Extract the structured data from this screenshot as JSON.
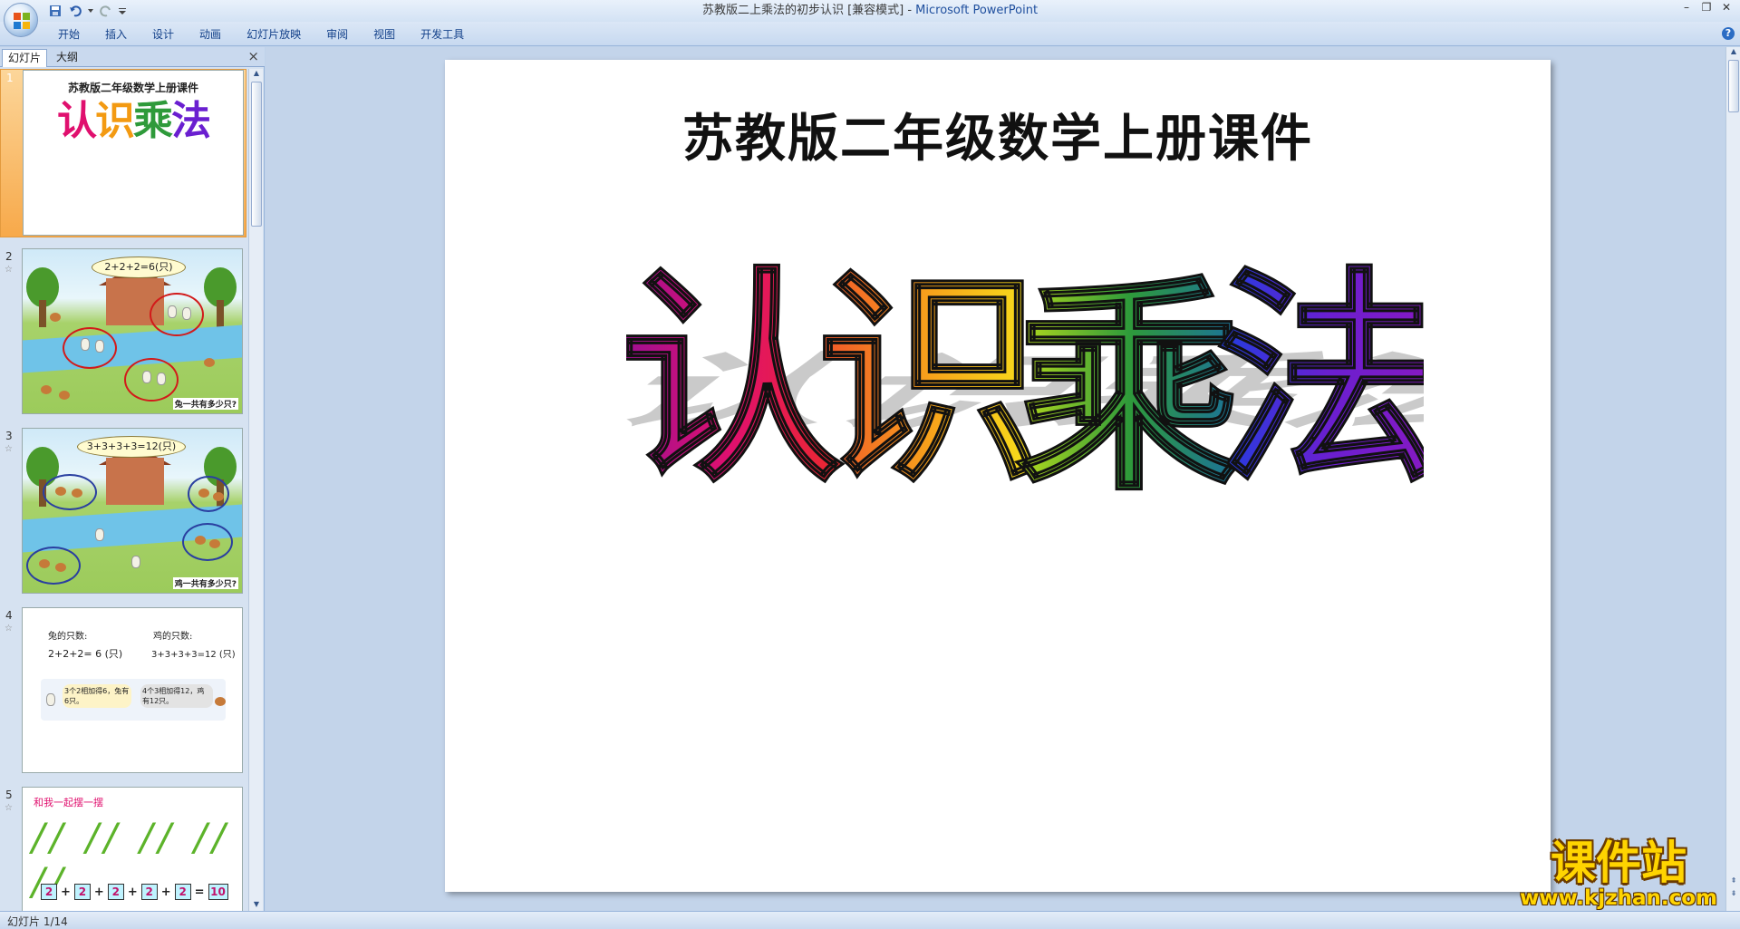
{
  "window": {
    "title_doc": "苏教版二上乘法的初步认识 [兼容模式] - ",
    "title_app": "Microsoft PowerPoint",
    "minimize": "–",
    "restore": "❐",
    "close": "✕"
  },
  "ribbon": {
    "tabs": [
      "开始",
      "插入",
      "设计",
      "动画",
      "幻灯片放映",
      "审阅",
      "视图",
      "开发工具"
    ],
    "help": "?"
  },
  "left_panel": {
    "tab_slides": "幻灯片",
    "tab_outline": "大纲",
    "close": "×",
    "thumbnails": [
      {
        "number": "1",
        "title": "苏教版二年级数学上册课件",
        "wordart": "认识乘法"
      },
      {
        "number": "2",
        "bubble": "2+2+2=6(只)",
        "caption": "兔一共有多少只?"
      },
      {
        "number": "3",
        "bubble": "3+3+3+3=12(只)",
        "caption": "鸡一共有多少只?"
      },
      {
        "number": "4",
        "left_label": "兔的只数:",
        "left_eq": "2+2+2= 6 (只)",
        "right_label": "鸡的只数:",
        "right_eq": "3+3+3+3=12 (只)",
        "note_left": "3个2相加得6，兔有6只。",
        "note_right": "4个3相加得12，鸡有12只。"
      },
      {
        "number": "5",
        "heading": "和我一起摆一摆",
        "sticks": "// // // // //",
        "numbers": [
          "2",
          "2",
          "2",
          "2",
          "2"
        ],
        "plus": "+",
        "equals": "=",
        "result": "10"
      }
    ]
  },
  "slide": {
    "title": "苏教版二年级数学上册课件",
    "wordart": [
      "认",
      "识",
      "乘",
      "法"
    ]
  },
  "watermark": {
    "cn": "课件站",
    "url": "www.kjzhan.com"
  },
  "status": {
    "text": "幻灯片 1/14"
  },
  "colors": {
    "wordart_1": "#e0106e",
    "wordart_2": "#f7a21b",
    "wordart_3": "#2e9a3a",
    "wordart_4": "#6a1fd0",
    "selection": "#f7a94a"
  }
}
